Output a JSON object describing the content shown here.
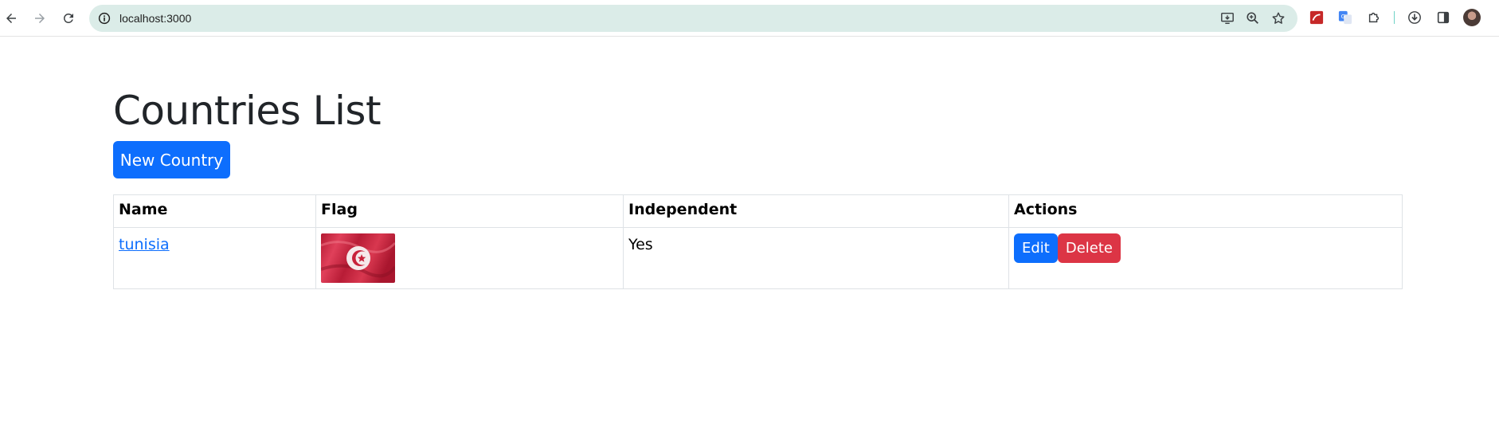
{
  "browser": {
    "url": "localhost:3000"
  },
  "page": {
    "title": "Countries List",
    "new_button_label": "New Country"
  },
  "table": {
    "headers": {
      "name": "Name",
      "flag": "Flag",
      "independent": "Independent",
      "actions": "Actions"
    },
    "rows": [
      {
        "name": "tunisia",
        "independent": "Yes",
        "edit_label": "Edit",
        "delete_label": "Delete"
      }
    ]
  },
  "colors": {
    "primary": "#0d6efd",
    "danger": "#dc3545",
    "flag_red": "#c8213a"
  }
}
